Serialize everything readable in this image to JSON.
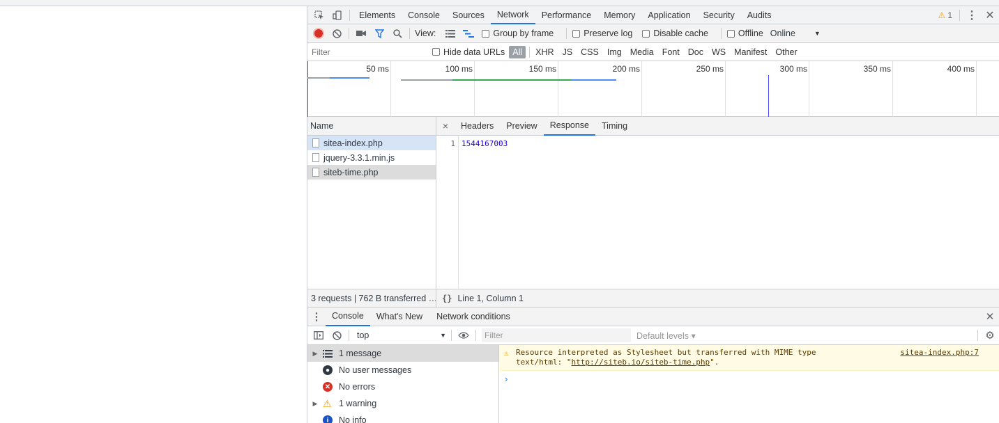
{
  "devtools": {
    "tabs": [
      "Elements",
      "Console",
      "Sources",
      "Network",
      "Performance",
      "Memory",
      "Application",
      "Security",
      "Audits"
    ],
    "active_tab": "Network",
    "warning_count": "1"
  },
  "network_toolbar": {
    "view_label": "View:",
    "group_by_frame": "Group by frame",
    "preserve_log": "Preserve log",
    "disable_cache": "Disable cache",
    "offline": "Offline",
    "throttling": "Online"
  },
  "filter_bar": {
    "placeholder": "Filter",
    "hide_data_urls": "Hide data URLs",
    "types": [
      "All",
      "XHR",
      "JS",
      "CSS",
      "Img",
      "Media",
      "Font",
      "Doc",
      "WS",
      "Manifest",
      "Other"
    ],
    "selected_type": "All"
  },
  "timeline": {
    "ticks": [
      "50 ms",
      "100 ms",
      "150 ms",
      "200 ms",
      "250 ms",
      "300 ms",
      "350 ms",
      "400 ms"
    ]
  },
  "requests": {
    "header": "Name",
    "items": [
      "sitea-index.php",
      "jquery-3.3.1.min.js",
      "siteb-time.php"
    ]
  },
  "detail": {
    "close": "×",
    "tabs": [
      "Headers",
      "Preview",
      "Response",
      "Timing"
    ],
    "active_tab": "Response",
    "line_number": "1",
    "response_body": "1544167003"
  },
  "status": {
    "summary": "3 requests | 762 B transferred …",
    "pretty_print": "{}",
    "cursor": "Line 1, Column 1"
  },
  "drawer": {
    "tabs": [
      "Console",
      "What's New",
      "Network conditions"
    ],
    "active_tab": "Console"
  },
  "console_toolbar": {
    "context": "top",
    "filter_placeholder": "Filter",
    "levels": "Default levels ▾"
  },
  "console_sidebar": {
    "items": [
      {
        "label": "1 message",
        "icon": "list-icon"
      },
      {
        "label": "No user messages",
        "icon": "user-icon"
      },
      {
        "label": "No errors",
        "icon": "error-icon"
      },
      {
        "label": "1 warning",
        "icon": "warning-icon"
      },
      {
        "label": "No info",
        "icon": "info-icon"
      }
    ]
  },
  "console_messages": {
    "warning_text_1": "Resource interpreted as Stylesheet but transferred with MIME type",
    "warning_text_2_pre": "text/html: \"",
    "warning_link": "http://siteb.io/siteb-time.php",
    "warning_text_2_post": "\".",
    "warning_source": "sitea-index.php:7"
  },
  "colors": {
    "accent": "#1a73e8",
    "record": "#d93025",
    "warning": "#f4a000"
  }
}
